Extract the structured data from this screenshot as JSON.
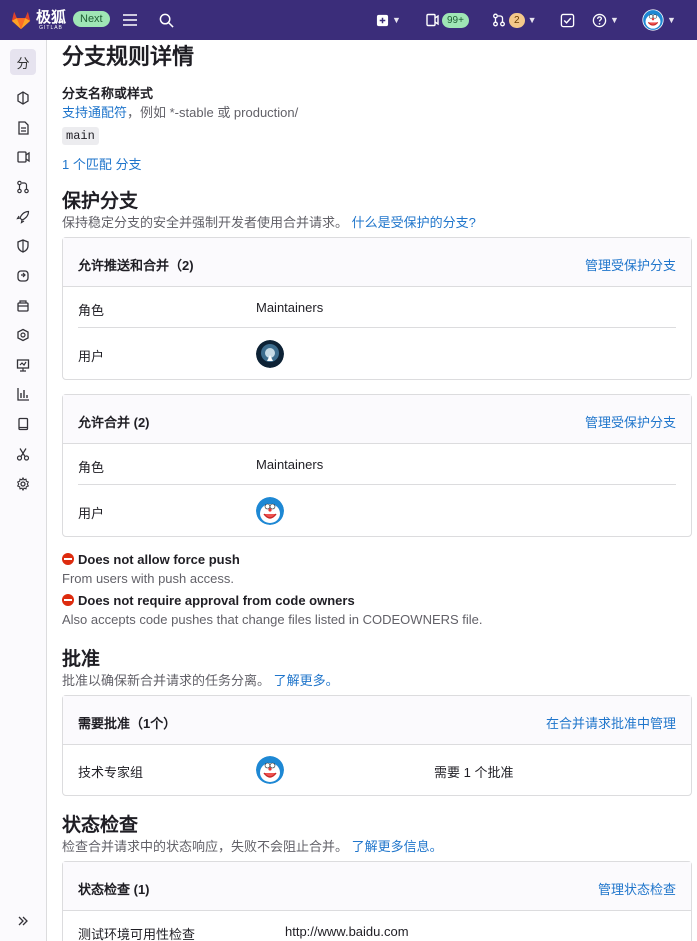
{
  "topbar": {
    "logo_cn": "极狐",
    "logo_en": "GITLAB",
    "next_badge": "Next",
    "mr_count": "99+",
    "todo_count": "2"
  },
  "sidebar": {
    "active_label": "分"
  },
  "page": {
    "title": "分支规则详情",
    "branch_name_label": "分支名称或样式",
    "wildcard_link": "支持通配符",
    "wildcard_hint": "，例如 *-stable 或 production/",
    "branch_code": "main",
    "match_link": "1 个匹配 分支"
  },
  "protect": {
    "heading": "保护分支",
    "desc": "保持稳定分支的安全并强制开发者使用合并请求。",
    "help_link": "什么是受保护的分支?",
    "push_card": {
      "title": "允许推送和合并（2)",
      "action": "管理受保护分支",
      "role_label": "角色",
      "role_value": "Maintainers",
      "user_label": "用户"
    },
    "merge_card": {
      "title": "允许合并 (2)",
      "action": "管理受保护分支",
      "role_label": "角色",
      "role_value": "Maintainers",
      "user_label": "用户"
    },
    "force_push_title": "Does not allow force push",
    "force_push_desc": "From users with push access.",
    "codeowners_title": "Does not require approval from code owners",
    "codeowners_desc": "Also accepts code pushes that change files listed in CODEOWNERS file."
  },
  "approvals": {
    "heading": "批准",
    "desc": "批准以确保新合并请求的任务分离。",
    "learn_link": "了解更多。",
    "card": {
      "title": "需要批准（1个）",
      "action": "在合并请求批准中管理",
      "group_name": "技术专家组",
      "required": "需要 1 个批准"
    }
  },
  "status_checks": {
    "heading": "状态检查",
    "desc": "检查合并请求中的状态响应，失败不会阻止合并。",
    "learn_link": "了解更多信息。",
    "card": {
      "title": "状态检查 (1)",
      "action": "管理状态检查",
      "check_name": "测试环境可用性检查",
      "check_url": "http://www.baidu.com"
    }
  },
  "colors": {
    "topbar_bg": "#3b2d7a",
    "link": "#1f75cb",
    "danger": "#dd2b0e",
    "badge_green": "#9fe6b5",
    "badge_orange": "#f5c98a"
  }
}
